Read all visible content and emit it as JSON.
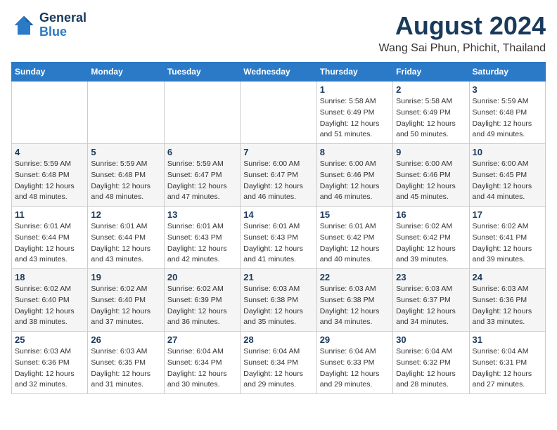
{
  "logo": {
    "line1": "General",
    "line2": "Blue"
  },
  "title": "August 2024",
  "subtitle": "Wang Sai Phun, Phichit, Thailand",
  "weekdays": [
    "Sunday",
    "Monday",
    "Tuesday",
    "Wednesday",
    "Thursday",
    "Friday",
    "Saturday"
  ],
  "weeks": [
    [
      {
        "day": "",
        "info": ""
      },
      {
        "day": "",
        "info": ""
      },
      {
        "day": "",
        "info": ""
      },
      {
        "day": "",
        "info": ""
      },
      {
        "day": "1",
        "info": "Sunrise: 5:58 AM\nSunset: 6:49 PM\nDaylight: 12 hours\nand 51 minutes."
      },
      {
        "day": "2",
        "info": "Sunrise: 5:58 AM\nSunset: 6:49 PM\nDaylight: 12 hours\nand 50 minutes."
      },
      {
        "day": "3",
        "info": "Sunrise: 5:59 AM\nSunset: 6:48 PM\nDaylight: 12 hours\nand 49 minutes."
      }
    ],
    [
      {
        "day": "4",
        "info": "Sunrise: 5:59 AM\nSunset: 6:48 PM\nDaylight: 12 hours\nand 48 minutes."
      },
      {
        "day": "5",
        "info": "Sunrise: 5:59 AM\nSunset: 6:48 PM\nDaylight: 12 hours\nand 48 minutes."
      },
      {
        "day": "6",
        "info": "Sunrise: 5:59 AM\nSunset: 6:47 PM\nDaylight: 12 hours\nand 47 minutes."
      },
      {
        "day": "7",
        "info": "Sunrise: 6:00 AM\nSunset: 6:47 PM\nDaylight: 12 hours\nand 46 minutes."
      },
      {
        "day": "8",
        "info": "Sunrise: 6:00 AM\nSunset: 6:46 PM\nDaylight: 12 hours\nand 46 minutes."
      },
      {
        "day": "9",
        "info": "Sunrise: 6:00 AM\nSunset: 6:46 PM\nDaylight: 12 hours\nand 45 minutes."
      },
      {
        "day": "10",
        "info": "Sunrise: 6:00 AM\nSunset: 6:45 PM\nDaylight: 12 hours\nand 44 minutes."
      }
    ],
    [
      {
        "day": "11",
        "info": "Sunrise: 6:01 AM\nSunset: 6:44 PM\nDaylight: 12 hours\nand 43 minutes."
      },
      {
        "day": "12",
        "info": "Sunrise: 6:01 AM\nSunset: 6:44 PM\nDaylight: 12 hours\nand 43 minutes."
      },
      {
        "day": "13",
        "info": "Sunrise: 6:01 AM\nSunset: 6:43 PM\nDaylight: 12 hours\nand 42 minutes."
      },
      {
        "day": "14",
        "info": "Sunrise: 6:01 AM\nSunset: 6:43 PM\nDaylight: 12 hours\nand 41 minutes."
      },
      {
        "day": "15",
        "info": "Sunrise: 6:01 AM\nSunset: 6:42 PM\nDaylight: 12 hours\nand 40 minutes."
      },
      {
        "day": "16",
        "info": "Sunrise: 6:02 AM\nSunset: 6:42 PM\nDaylight: 12 hours\nand 39 minutes."
      },
      {
        "day": "17",
        "info": "Sunrise: 6:02 AM\nSunset: 6:41 PM\nDaylight: 12 hours\nand 39 minutes."
      }
    ],
    [
      {
        "day": "18",
        "info": "Sunrise: 6:02 AM\nSunset: 6:40 PM\nDaylight: 12 hours\nand 38 minutes."
      },
      {
        "day": "19",
        "info": "Sunrise: 6:02 AM\nSunset: 6:40 PM\nDaylight: 12 hours\nand 37 minutes."
      },
      {
        "day": "20",
        "info": "Sunrise: 6:02 AM\nSunset: 6:39 PM\nDaylight: 12 hours\nand 36 minutes."
      },
      {
        "day": "21",
        "info": "Sunrise: 6:03 AM\nSunset: 6:38 PM\nDaylight: 12 hours\nand 35 minutes."
      },
      {
        "day": "22",
        "info": "Sunrise: 6:03 AM\nSunset: 6:38 PM\nDaylight: 12 hours\nand 34 minutes."
      },
      {
        "day": "23",
        "info": "Sunrise: 6:03 AM\nSunset: 6:37 PM\nDaylight: 12 hours\nand 34 minutes."
      },
      {
        "day": "24",
        "info": "Sunrise: 6:03 AM\nSunset: 6:36 PM\nDaylight: 12 hours\nand 33 minutes."
      }
    ],
    [
      {
        "day": "25",
        "info": "Sunrise: 6:03 AM\nSunset: 6:36 PM\nDaylight: 12 hours\nand 32 minutes."
      },
      {
        "day": "26",
        "info": "Sunrise: 6:03 AM\nSunset: 6:35 PM\nDaylight: 12 hours\nand 31 minutes."
      },
      {
        "day": "27",
        "info": "Sunrise: 6:04 AM\nSunset: 6:34 PM\nDaylight: 12 hours\nand 30 minutes."
      },
      {
        "day": "28",
        "info": "Sunrise: 6:04 AM\nSunset: 6:34 PM\nDaylight: 12 hours\nand 29 minutes."
      },
      {
        "day": "29",
        "info": "Sunrise: 6:04 AM\nSunset: 6:33 PM\nDaylight: 12 hours\nand 29 minutes."
      },
      {
        "day": "30",
        "info": "Sunrise: 6:04 AM\nSunset: 6:32 PM\nDaylight: 12 hours\nand 28 minutes."
      },
      {
        "day": "31",
        "info": "Sunrise: 6:04 AM\nSunset: 6:31 PM\nDaylight: 12 hours\nand 27 minutes."
      }
    ]
  ]
}
